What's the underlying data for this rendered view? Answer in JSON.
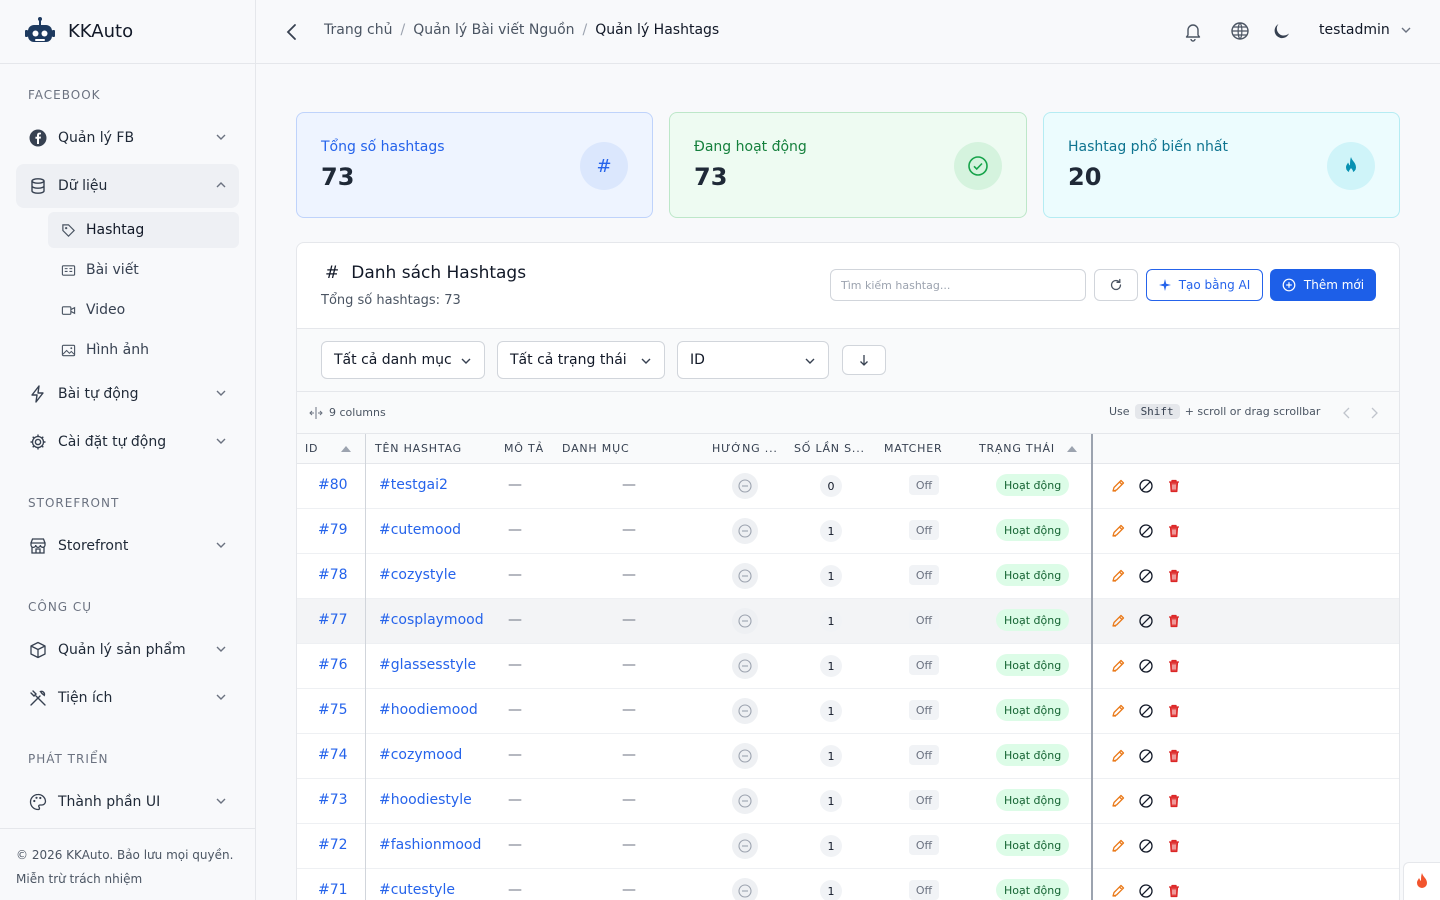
{
  "brand": {
    "name": "KKAuto"
  },
  "sidebar": {
    "sections": [
      "FACEBOOK",
      "STOREFRONT",
      "CÔNG CỤ",
      "PHÁT TRIỂN"
    ],
    "items": [
      {
        "label": "Quản lý FB",
        "icon": "facebook-icon"
      },
      {
        "label": "Dữ liệu",
        "icon": "database-icon"
      },
      {
        "label": "Bài tự động",
        "icon": "lightning-icon"
      },
      {
        "label": "Cài đặt tự động",
        "icon": "gear-icon"
      },
      {
        "label": "Storefront",
        "icon": "store-icon"
      },
      {
        "label": "Quản lý sản phẩm",
        "icon": "box-icon"
      },
      {
        "label": "Tiện ích",
        "icon": "tools-icon"
      },
      {
        "label": "Thành phần UI",
        "icon": "palette-icon"
      }
    ],
    "sub_items": [
      {
        "label": "Hashtag",
        "icon": "tag-icon"
      },
      {
        "label": "Bài viết",
        "icon": "article-icon"
      },
      {
        "label": "Video",
        "icon": "video-icon"
      },
      {
        "label": "Hình ảnh",
        "icon": "image-icon"
      }
    ],
    "footer": {
      "copyright": "© 2026 KKAuto. Bảo lưu mọi quyền.",
      "disclaimer": "Miễn trừ trách nhiệm"
    }
  },
  "header": {
    "breadcrumb": [
      "Trang chủ",
      "Quản lý Bài viết Nguồn",
      "Quản lý Hashtags"
    ],
    "separator": "/",
    "user": "testadmin"
  },
  "stats": [
    {
      "label": "Tổng số hashtags",
      "value": "73",
      "icon": "#",
      "color": "#2563eb"
    },
    {
      "label": "Đang hoạt động",
      "value": "73",
      "icon": "check-circle-icon",
      "color": "#15803d"
    },
    {
      "label": "Hashtag phổ biến nhất",
      "value": "20",
      "icon": "fire-icon",
      "color": "#0e7490"
    }
  ],
  "panel": {
    "title": "Danh sách Hashtags",
    "title_icon": "#",
    "subtitle": "Tổng số hashtags: 73",
    "search_placeholder": "Tìm kiếm hashtag...",
    "ai_button": "Tạo bằng AI",
    "add_button": "Thêm mới"
  },
  "filters": {
    "category": "Tất cả danh mục",
    "status": "Tất cả trạng thái",
    "sort": "ID"
  },
  "toolbar": {
    "columns": "9 columns",
    "hint_prefix": "Use",
    "hint_key": "Shift",
    "hint_suffix": "+ scroll or drag scrollbar"
  },
  "table": {
    "headers": [
      "ID",
      "TÊN HASHTAG",
      "MÔ TẢ",
      "DANH MỤC",
      "HƯỚNG ...",
      "SỐ LẦN S...",
      "MATCHER",
      "TRẠNG THÁI"
    ],
    "rows": [
      {
        "id": "#80",
        "name": "#testgai2",
        "desc": "—",
        "cat": "—",
        "count": "0",
        "matcher": "Off",
        "status": "Hoạt động"
      },
      {
        "id": "#79",
        "name": "#cutemood",
        "desc": "—",
        "cat": "—",
        "count": "1",
        "matcher": "Off",
        "status": "Hoạt động"
      },
      {
        "id": "#78",
        "name": "#cozystyle",
        "desc": "—",
        "cat": "—",
        "count": "1",
        "matcher": "Off",
        "status": "Hoạt động"
      },
      {
        "id": "#77",
        "name": "#cosplaymood",
        "desc": "—",
        "cat": "—",
        "count": "1",
        "matcher": "Off",
        "status": "Hoạt động"
      },
      {
        "id": "#76",
        "name": "#glassesstyle",
        "desc": "—",
        "cat": "—",
        "count": "1",
        "matcher": "Off",
        "status": "Hoạt động"
      },
      {
        "id": "#75",
        "name": "#hoodiemood",
        "desc": "—",
        "cat": "—",
        "count": "1",
        "matcher": "Off",
        "status": "Hoạt động"
      },
      {
        "id": "#74",
        "name": "#cozymood",
        "desc": "—",
        "cat": "—",
        "count": "1",
        "matcher": "Off",
        "status": "Hoạt động"
      },
      {
        "id": "#73",
        "name": "#hoodiestyle",
        "desc": "—",
        "cat": "—",
        "count": "1",
        "matcher": "Off",
        "status": "Hoạt động"
      },
      {
        "id": "#72",
        "name": "#fashionmood",
        "desc": "—",
        "cat": "—",
        "count": "1",
        "matcher": "Off",
        "status": "Hoạt động"
      },
      {
        "id": "#71",
        "name": "#cutestyle",
        "desc": "—",
        "cat": "—",
        "count": "1",
        "matcher": "Off",
        "status": "Hoạt động"
      }
    ]
  }
}
